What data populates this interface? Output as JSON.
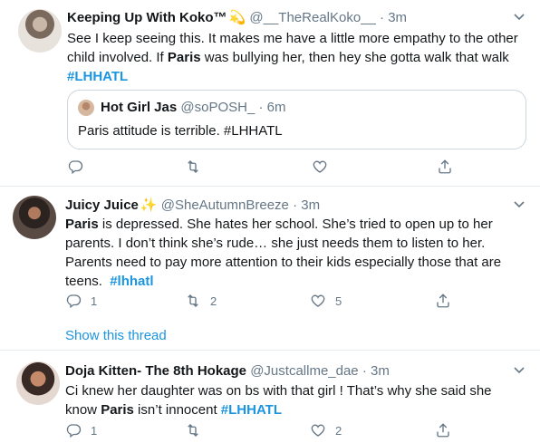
{
  "tweets": [
    {
      "name": "Keeping Up With Koko™",
      "name_emoji": "💫",
      "handle": "@__TheRealKoko__",
      "time": "· 3m",
      "text_parts": {
        "p1": "See I keep seeing this. It makes me have a little more empathy to the other child involved. If ",
        "bold1": "Paris",
        "p2": " was bullying her, then hey she gotta walk that walk",
        "hashtag": "#LHHATL"
      },
      "quote": {
        "name": "Hot Girl Jas",
        "handle": "@soPOSH_",
        "time": "· 6m",
        "text": "Paris attitude is terrible.  #LHHATL"
      },
      "actions": {
        "reply": "",
        "retweet": "",
        "like": ""
      }
    },
    {
      "name": "Juicy Juice",
      "name_emoji": "✨",
      "handle": "@SheAutumnBreeze",
      "time": "· 3m",
      "text_parts": {
        "bold1": "Paris",
        "p1": " is depressed. She hates her school. She’s tried to open up to her parents. I don’t think she’s rude… she just needs them to listen to her. Parents need to pay more attention to their kids especially those that are teens.",
        "hashtag": "#lhhatl"
      },
      "actions": {
        "reply": "1",
        "retweet": "2",
        "like": "5"
      },
      "show_thread": "Show this thread"
    },
    {
      "name": "Doja Kitten- The 8th Hokage",
      "handle": "@Justcallme_dae",
      "time": "· 3m",
      "text_parts": {
        "p1": "Ci knew her daughter was on bs with that girl ! That’s why she said she know ",
        "bold1": "Paris",
        "p2": " isn’t innocent ",
        "hashtag": "#LHHATL"
      },
      "actions": {
        "reply": "1",
        "retweet": "",
        "like": "2"
      }
    }
  ],
  "icons": {
    "reply": "reply-icon",
    "retweet": "retweet-icon",
    "like": "heart-icon",
    "share": "share-icon",
    "more": "chevron-down-icon"
  },
  "colors": {
    "link": "#1b95e0",
    "secondary": "#657786",
    "divider": "#e6ecf0"
  }
}
